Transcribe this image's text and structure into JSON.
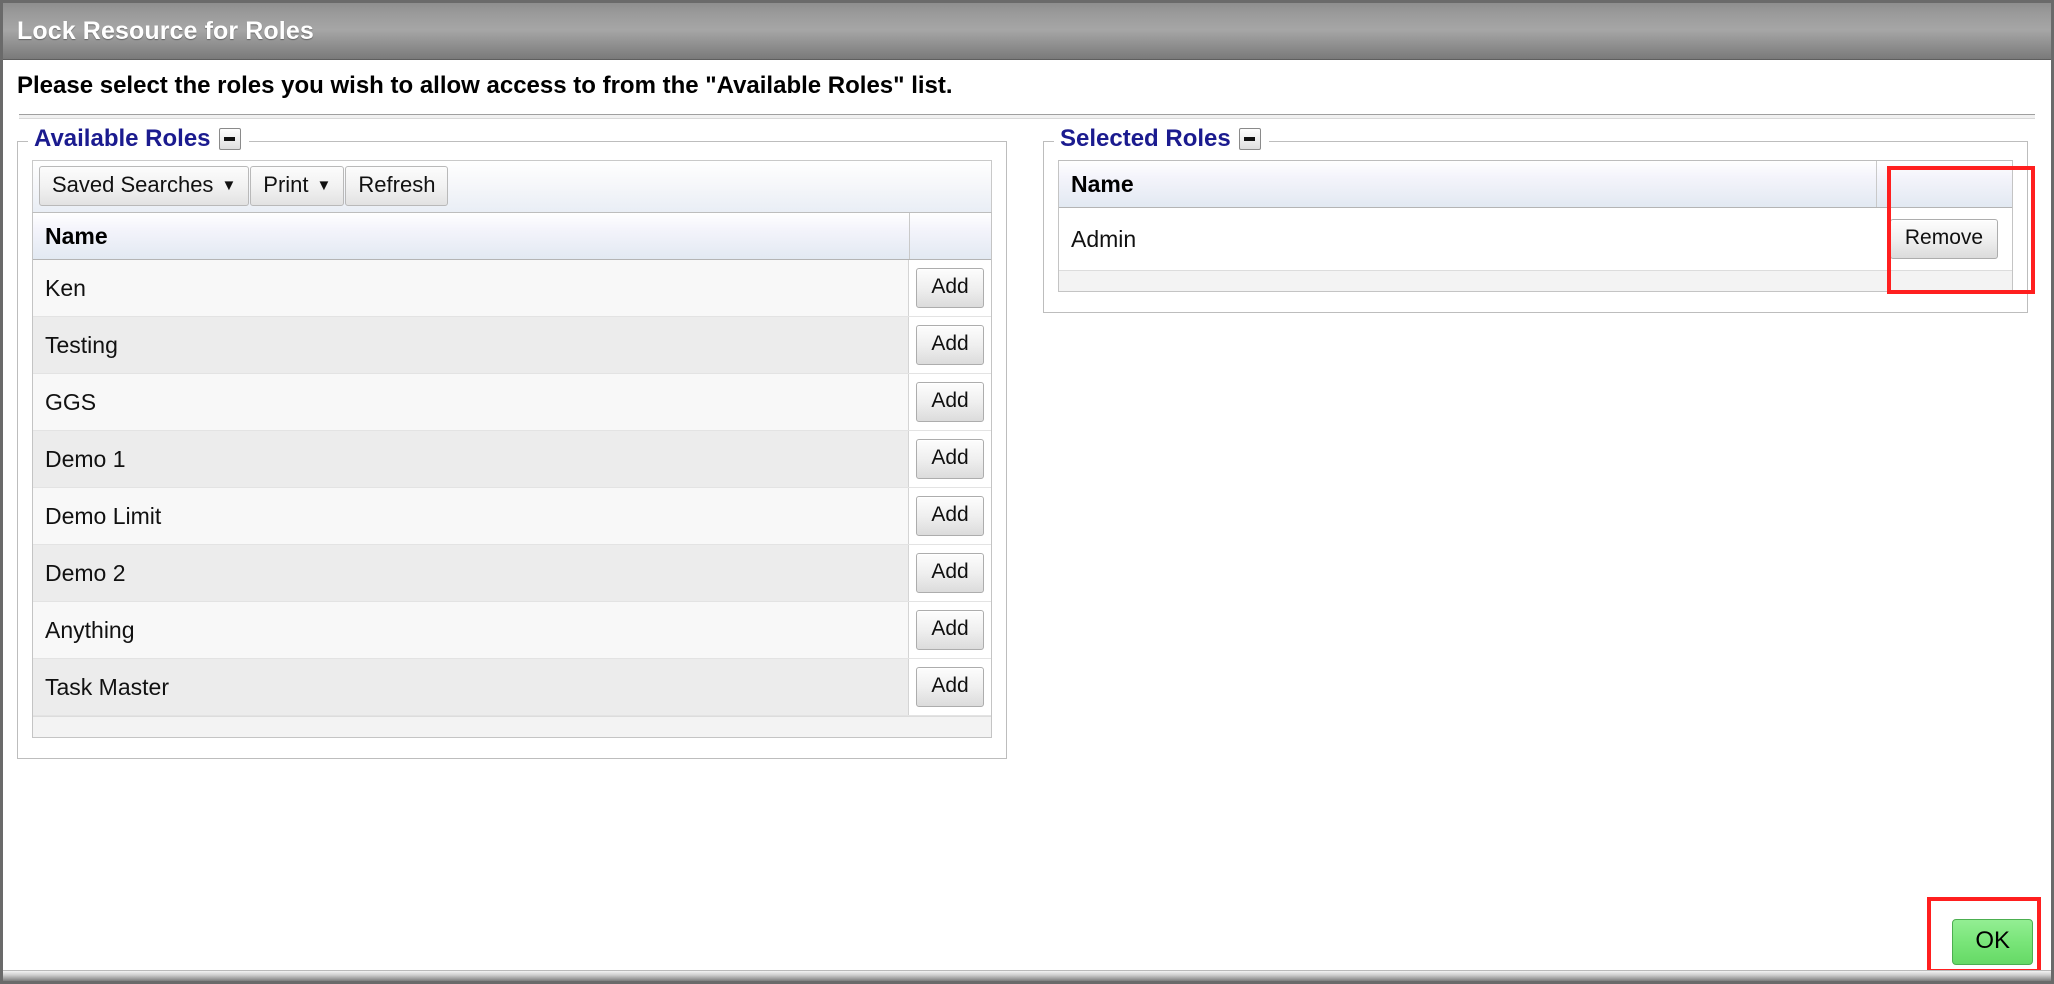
{
  "window": {
    "title": "Lock Resource for Roles"
  },
  "instruction": {
    "text": "Please select the roles you wish to allow access to from the \"Available Roles\" list."
  },
  "available_panel": {
    "legend": "Available Roles",
    "collapse_icon": "minus-icon",
    "toolbar": {
      "saved_searches_label": "Saved Searches",
      "saved_searches_caret": "▼",
      "print_label": "Print",
      "print_caret": "▼",
      "refresh_label": "Refresh"
    },
    "columns": [
      "Name",
      ""
    ],
    "action_label": "Add",
    "rows": [
      {
        "name": "Ken",
        "action": "Add"
      },
      {
        "name": "Testing",
        "action": "Add"
      },
      {
        "name": "GGS",
        "action": "Add"
      },
      {
        "name": "Demo 1",
        "action": "Add"
      },
      {
        "name": "Demo Limit",
        "action": "Add"
      },
      {
        "name": "Demo 2",
        "action": "Add"
      },
      {
        "name": "Anything",
        "action": "Add"
      },
      {
        "name": "Task Master",
        "action": "Add"
      }
    ]
  },
  "selected_panel": {
    "legend": "Selected Roles",
    "collapse_icon": "minus-icon",
    "columns": [
      "Name",
      ""
    ],
    "action_label": "Remove",
    "rows": [
      {
        "name": "Admin",
        "action": "Remove"
      }
    ]
  },
  "footer": {
    "ok_label": "OK"
  },
  "colors": {
    "legend_blue": "#1b1b8f",
    "annotation_red": "#ff1f1f",
    "ok_green": "#79e579",
    "titlebar_gray": "#9a9a9a"
  }
}
